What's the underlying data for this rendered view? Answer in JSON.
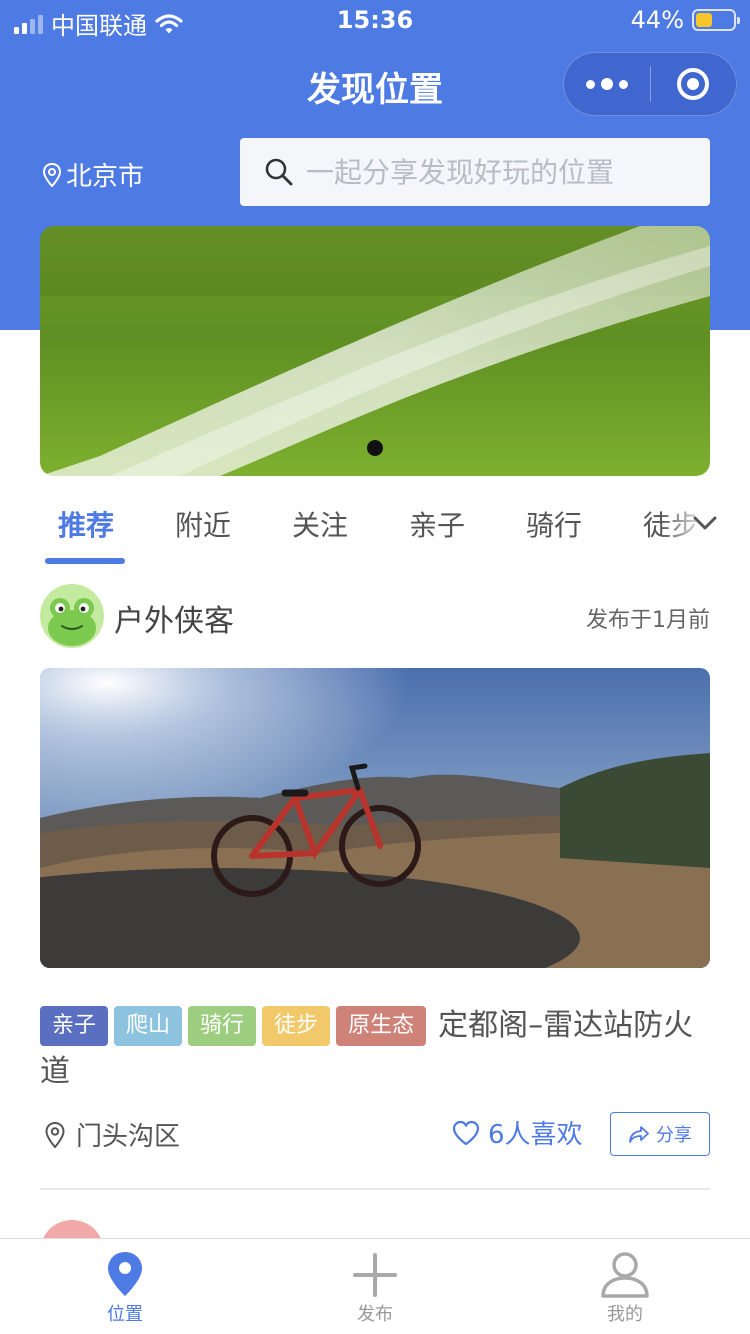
{
  "status_bar": {
    "carrier": "中国联通",
    "time": "15:36",
    "battery": "44%",
    "battery_level": 0.44
  },
  "nav": {
    "title": "发现位置"
  },
  "location": {
    "city": "北京市"
  },
  "search": {
    "placeholder": "一起分享发现好玩的位置"
  },
  "banner": {
    "active_slide": 1,
    "slide_count": 1
  },
  "tabs": [
    {
      "label": "推荐",
      "active": true
    },
    {
      "label": "附近"
    },
    {
      "label": "关注"
    },
    {
      "label": "亲子"
    },
    {
      "label": "骑行"
    },
    {
      "label": "徒步"
    }
  ],
  "post": {
    "author": "户外侠客",
    "time": "发布于1月前",
    "tags": [
      {
        "label": "亲子",
        "color": "#5a6fc0"
      },
      {
        "label": "爬山",
        "color": "#8ec3e0"
      },
      {
        "label": "骑行",
        "color": "#9dce7f"
      },
      {
        "label": "徒步",
        "color": "#f1c86a"
      },
      {
        "label": "原生态",
        "color": "#cf8378"
      }
    ],
    "title": "定都阁–雷达站防火道",
    "district": "门头沟区",
    "likes": "6人喜欢",
    "share": "分享"
  },
  "colors": {
    "brand": "#4e7ae3"
  },
  "tabbar": [
    {
      "label": "位置",
      "icon": "location-pin-icon",
      "active": true
    },
    {
      "label": "发布",
      "icon": "plus-icon"
    },
    {
      "label": "我的",
      "icon": "user-icon"
    }
  ]
}
